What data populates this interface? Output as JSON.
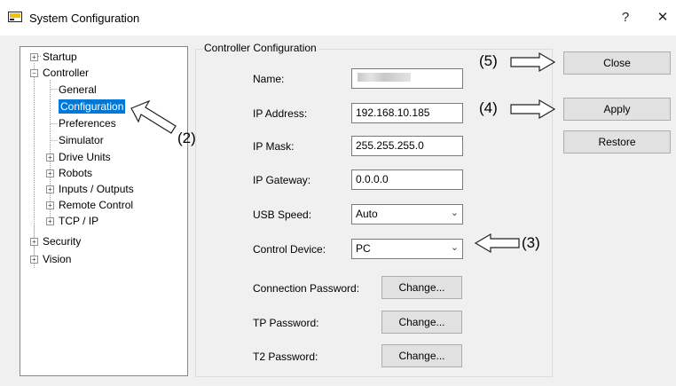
{
  "window": {
    "title": "System Configuration",
    "help_label": "?",
    "close_label": "✕"
  },
  "tree": {
    "items": [
      {
        "label": "Startup",
        "expander": "+"
      },
      {
        "label": "Controller",
        "expander": "−"
      },
      {
        "label": "General"
      },
      {
        "label": "Configuration"
      },
      {
        "label": "Preferences"
      },
      {
        "label": "Simulator"
      },
      {
        "label": "Drive Units",
        "expander": "+"
      },
      {
        "label": "Robots",
        "expander": "+"
      },
      {
        "label": "Inputs / Outputs",
        "expander": "+"
      },
      {
        "label": "Remote Control",
        "expander": "+"
      },
      {
        "label": "TCP / IP",
        "expander": "+"
      },
      {
        "label": "Security",
        "expander": "+"
      },
      {
        "label": "Vision",
        "expander": "+"
      }
    ],
    "selected": "Configuration"
  },
  "group": {
    "title": "Controller Configuration",
    "name_label": "Name:",
    "name_value": "",
    "ip_label": "IP Address:",
    "ip_value": "192.168.10.185",
    "mask_label": "IP Mask:",
    "mask_value": "255.255.255.0",
    "gateway_label": "IP Gateway:",
    "gateway_value": "0.0.0.0",
    "usb_label": "USB Speed:",
    "usb_value": "Auto",
    "device_label": "Control Device:",
    "device_value": "PC",
    "conn_pw_label": "Connection Password:",
    "tp_pw_label": "TP Password:",
    "t2_pw_label": "T2 Password:",
    "change_label": "Change..."
  },
  "buttons": {
    "close": "Close",
    "apply": "Apply",
    "restore": "Restore"
  },
  "callouts": {
    "c2": "(2)",
    "c3": "(3)",
    "c4": "(4)",
    "c5": "(5)"
  }
}
